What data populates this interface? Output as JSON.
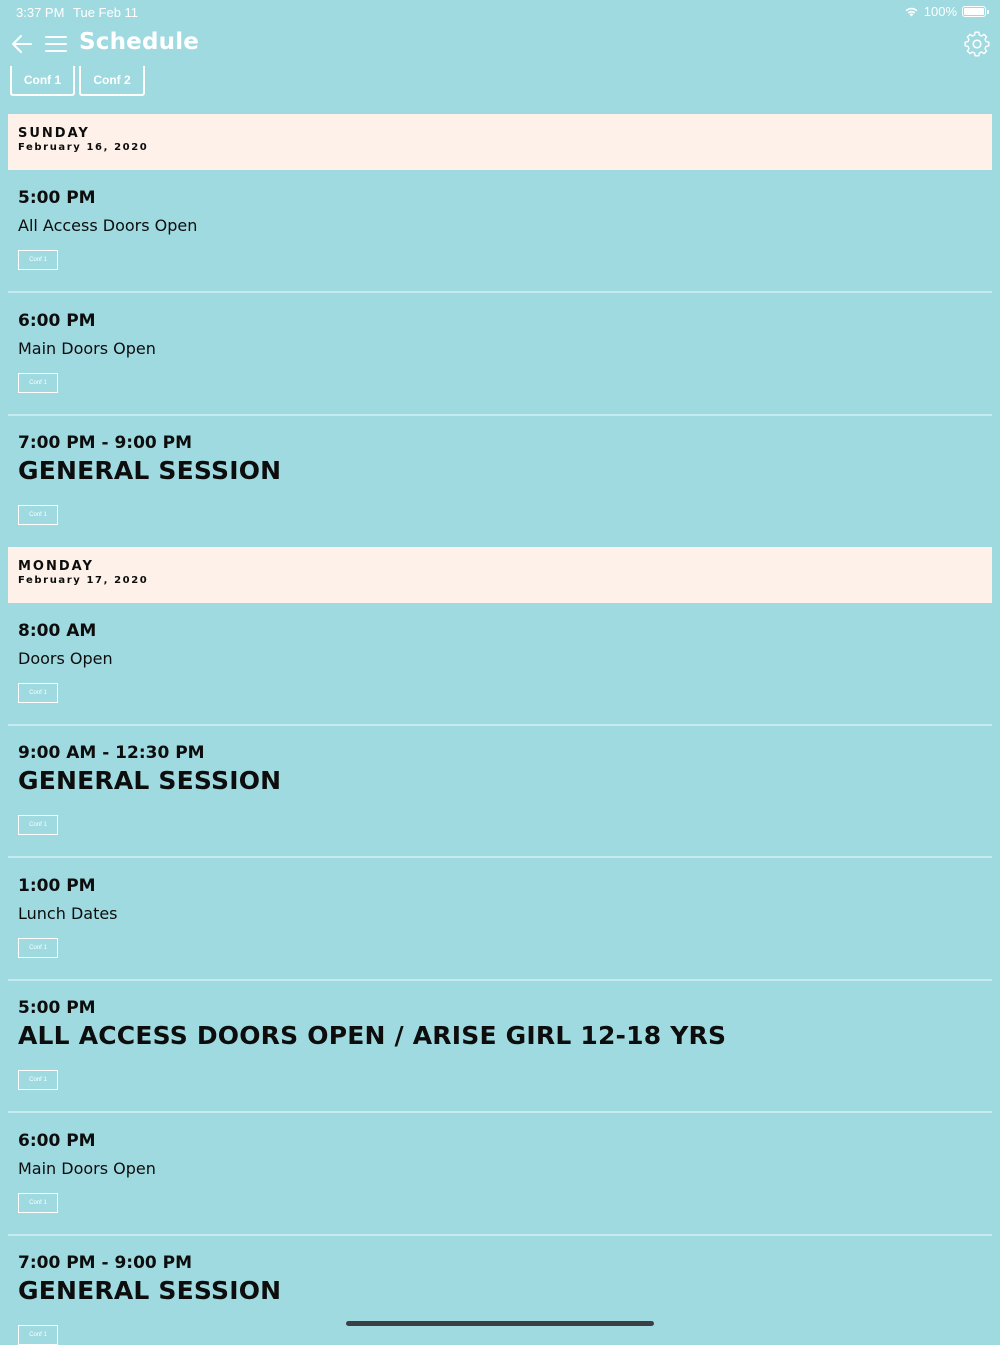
{
  "status_bar": {
    "time": "3:37 PM",
    "date": "Tue Feb 11",
    "battery_text": "100%",
    "battery_level": 1.0,
    "wifi_icon": "wifi-icon",
    "battery_icon": "battery-icon"
  },
  "nav": {
    "title": "Schedule",
    "back_icon": "back-arrow-icon",
    "menu_icon": "hamburger-menu-icon",
    "settings_icon": "gear-icon"
  },
  "filter_tabs": [
    {
      "label": "Conf 1"
    },
    {
      "label": "Conf 2"
    }
  ],
  "days": [
    {
      "name": "SUNDAY",
      "date": "February 16, 2020",
      "events": [
        {
          "time": "5:00 PM",
          "title": "All Access Doors Open",
          "tag": "Conf 1",
          "style": "normal"
        },
        {
          "time": "6:00 PM",
          "title": "Main Doors Open",
          "tag": "Conf 1",
          "style": "normal"
        },
        {
          "time": "7:00 PM - 9:00 PM",
          "title": "GENERAL SESSION",
          "tag": "Conf 1",
          "style": "big"
        }
      ]
    },
    {
      "name": "MONDAY",
      "date": "February 17, 2020",
      "events": [
        {
          "time": "8:00 AM",
          "title": "Doors Open",
          "tag": "Conf 1",
          "style": "normal"
        },
        {
          "time": "9:00 AM - 12:30 PM",
          "title": "GENERAL SESSION",
          "tag": "Conf 1",
          "style": "big"
        },
        {
          "time": "1:00 PM",
          "title": "Lunch Dates",
          "tag": "Conf 1",
          "style": "normal"
        },
        {
          "time": "5:00 PM",
          "title": "ALL ACCESS DOORS OPEN / ARISE GIRL 12-18 YRS",
          "tag": "Conf 1",
          "style": "big"
        },
        {
          "time": "6:00 PM",
          "title": "Main Doors Open",
          "tag": "Conf 1",
          "style": "normal"
        },
        {
          "time": "7:00 PM - 9:00 PM",
          "title": "GENERAL SESSION",
          "tag": "Conf 1",
          "style": "big"
        }
      ]
    }
  ],
  "colors": {
    "background": "#9fdae0",
    "day_header_bg": "#fdf1ea",
    "divider": "#c6eaee",
    "text": "#0d0d0d",
    "nav_text": "#ffffff"
  }
}
